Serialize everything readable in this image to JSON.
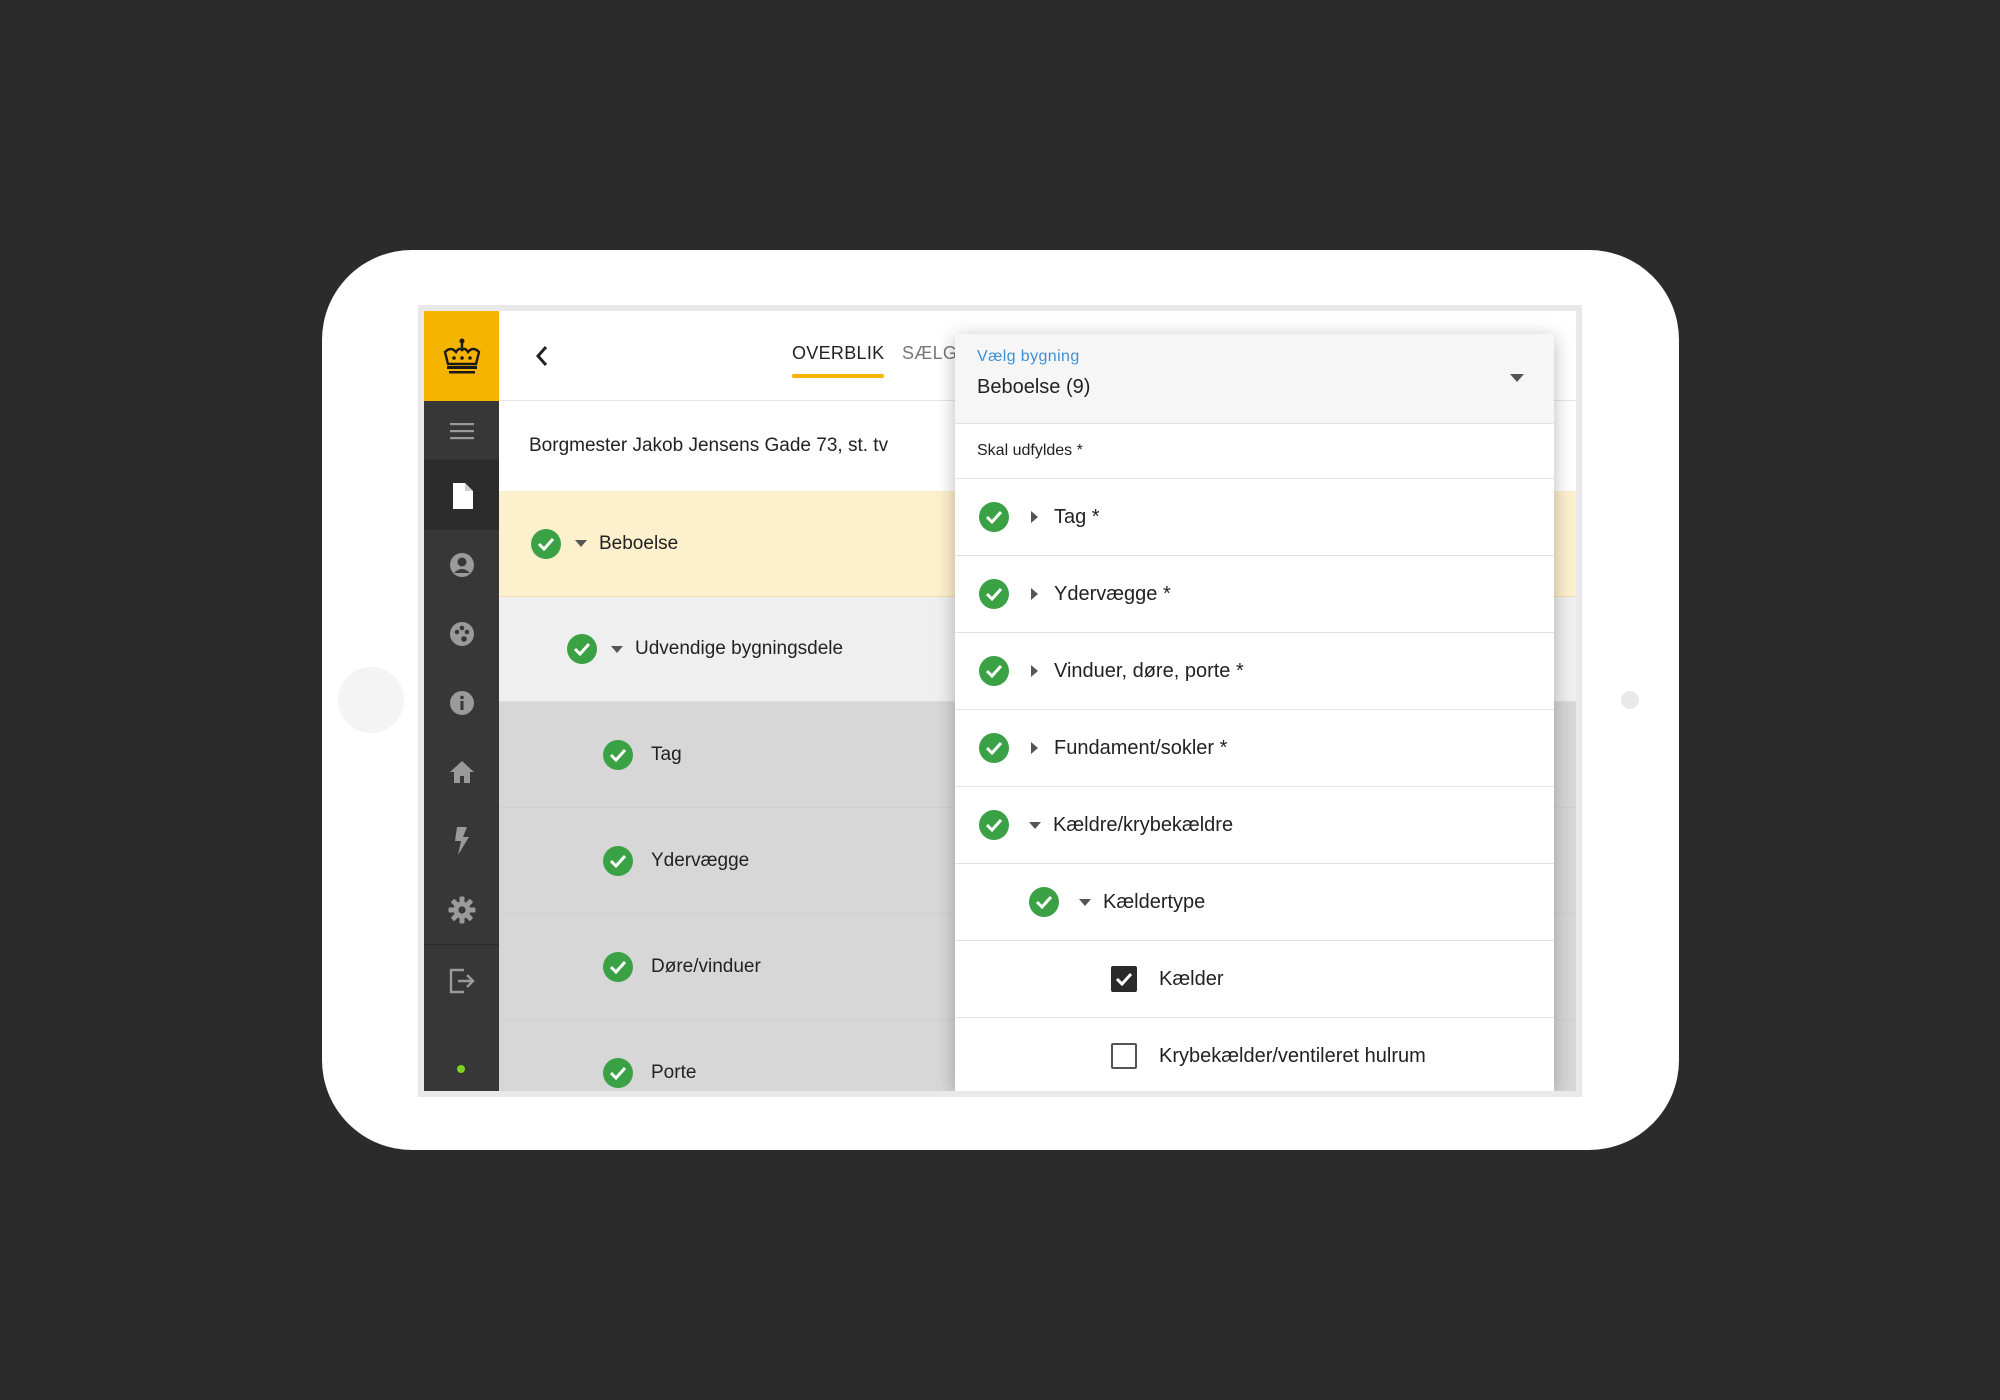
{
  "colors": {
    "background": "#2b2b2b",
    "accent": "#f5b400",
    "success": "#3aa145",
    "link": "#3d8fd6",
    "sidebar": "#373737"
  },
  "sidebar": {
    "logo_icon": "crown-icon",
    "items": [
      {
        "icon": "hamburger-menu-icon"
      },
      {
        "icon": "document-icon",
        "active": true
      },
      {
        "icon": "user-icon"
      },
      {
        "icon": "palette-icon"
      },
      {
        "icon": "info-icon"
      },
      {
        "icon": "home-icon"
      },
      {
        "icon": "lightning-icon"
      },
      {
        "icon": "gear-icon"
      },
      {
        "icon": "logout-icon"
      }
    ],
    "status": "online"
  },
  "header": {
    "back_icon": "chevron-left-icon",
    "tabs": [
      {
        "label": "OVERBLIK",
        "active": true
      },
      {
        "label": "SÆLG"
      }
    ]
  },
  "address": "Borgmester Jakob Jensens Gade 73, st. tv",
  "tree": [
    {
      "label": "Beboelse",
      "level": 0
    },
    {
      "label": "Udvendige bygningsdele",
      "level": 1
    },
    {
      "label": "Tag",
      "level": 2
    },
    {
      "label": "Ydervægge",
      "level": 2
    },
    {
      "label": "Døre/vinduer",
      "level": 2
    },
    {
      "label": "Porte",
      "level": 2
    }
  ],
  "panel": {
    "select_label": "Vælg bygning",
    "select_value": "Beboelse (9)",
    "required_heading": "Skal udfyldes *",
    "rows": [
      {
        "label": "Tag *"
      },
      {
        "label": "Ydervægge *"
      },
      {
        "label": "Vinduer, døre, porte *"
      },
      {
        "label": "Fundament/sokler *"
      },
      {
        "label": "Kældre/krybekældre"
      },
      {
        "label": "Kældertype"
      }
    ],
    "options": [
      {
        "label": "Kælder",
        "checked": true
      },
      {
        "label": "Krybekælder/ventileret hulrum",
        "checked": false
      }
    ]
  }
}
